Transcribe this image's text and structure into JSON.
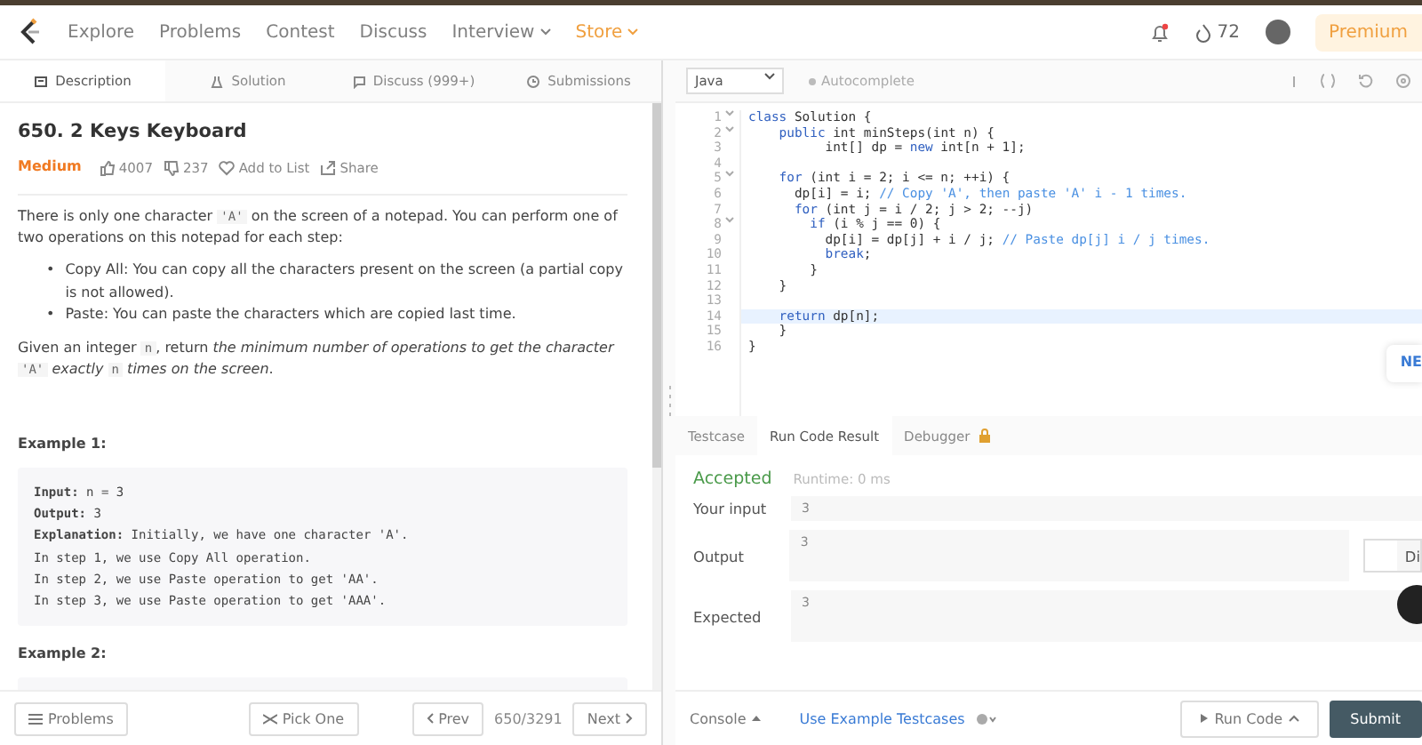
{
  "nav": {
    "links": [
      {
        "label": "Explore",
        "kind": "link"
      },
      {
        "label": "Problems",
        "kind": "link"
      },
      {
        "label": "Contest",
        "kind": "link"
      },
      {
        "label": "Discuss",
        "kind": "link"
      },
      {
        "label": "Interview",
        "kind": "menu"
      },
      {
        "label": "Store",
        "kind": "store"
      }
    ],
    "streak": "72",
    "premium": "Premium",
    "has_notification": true
  },
  "left": {
    "tabs": [
      {
        "label": "Description",
        "selected": true
      },
      {
        "label": "Solution",
        "selected": false
      },
      {
        "label": "Discuss (999+)",
        "selected": false
      },
      {
        "label": "Submissions",
        "selected": false
      }
    ],
    "title": "650. 2 Keys Keyboard",
    "difficulty": "Medium",
    "likes": "4007",
    "dislikes": "237",
    "add_to_list": "Add to List",
    "share": "Share",
    "intro": [
      {
        "text": "There is only one character ",
        "kind": "text"
      },
      {
        "text": "'A'",
        "kind": "code"
      },
      {
        "text": " on the screen of a notepad. You can perform one of two operations on this notepad for each step:",
        "kind": "text"
      }
    ],
    "bullets": [
      {
        "marker": "•",
        "text": "Copy All: You can copy all the characters present on the screen (a partial copy is not allowed)."
      },
      {
        "marker": "•",
        "text": "Paste: You can paste the characters which are copied last time."
      }
    ],
    "task": [
      {
        "text": "Given an integer ",
        "kind": "text"
      },
      {
        "text": "n",
        "kind": "code"
      },
      {
        "text": ", return ",
        "kind": "text"
      },
      {
        "text": "the minimum number of operations to get the character ",
        "kind": "italic"
      },
      {
        "text": "'A'",
        "kind": "code"
      },
      {
        "text": " exactly ",
        "kind": "italic"
      },
      {
        "text": "n",
        "kind": "code"
      },
      {
        "text": " times on the screen",
        "kind": "italic"
      },
      {
        "text": ".",
        "kind": "text"
      }
    ],
    "examples": [
      {
        "heading": "Example 1:",
        "lines": [
          "**Input:** n = 3",
          "**Output:** 3",
          "**Explanation:** Initially, we have one character 'A'.",
          "In step 1, we use Copy All operation.",
          "In step 2, we use Paste operation to get 'AA'.",
          "In step 3, we use Paste operation to get 'AAA'."
        ]
      },
      {
        "heading": "Example 2:"
      }
    ],
    "footer": {
      "problems": "Problems",
      "pick": "Pick One",
      "prev": "Prev",
      "count": "650/3291",
      "next": "Next"
    }
  },
  "editor": {
    "language": "Java",
    "autocomplete": "Autocomplete",
    "autocomplete_on": false,
    "lines": [
      {
        "num": "1",
        "fold": true,
        "highlighted": false,
        "segments": [
          {
            "text": "class",
            "kind": "keyword"
          },
          {
            "text": " Solution {",
            "kind": "plain"
          }
        ]
      },
      {
        "num": "2",
        "fold": true,
        "highlighted": false,
        "segments": [
          {
            "text": "    public",
            "kind": "keyword"
          },
          {
            "text": " int minSteps(int n) {",
            "kind": "plain"
          }
        ]
      },
      {
        "num": "3",
        "fold": false,
        "highlighted": false,
        "segments": [
          {
            "text": "          int[] dp = ",
            "kind": "plain"
          },
          {
            "text": "new",
            "kind": "keyword"
          },
          {
            "text": " int[n + 1];",
            "kind": "plain"
          }
        ]
      },
      {
        "num": "4",
        "fold": false,
        "highlighted": false
      },
      {
        "num": "5",
        "fold": true,
        "highlighted": false,
        "segments": [
          {
            "text": "    for",
            "kind": "keyword"
          },
          {
            "text": " (int i = 2; i <= n; ++i) {",
            "kind": "plain"
          }
        ]
      },
      {
        "num": "6",
        "fold": false,
        "highlighted": false,
        "segments": [
          {
            "text": "      dp[i] = i; ",
            "kind": "plain"
          },
          {
            "text": "// Copy 'A', then paste 'A' i - 1 times.",
            "kind": "comment"
          }
        ]
      },
      {
        "num": "7",
        "fold": false,
        "highlighted": false,
        "segments": [
          {
            "text": "      for",
            "kind": "keyword"
          },
          {
            "text": " (int j = i / 2; j > 2; --j)",
            "kind": "plain"
          }
        ]
      },
      {
        "num": "8",
        "fold": true,
        "highlighted": false,
        "segments": [
          {
            "text": "        if",
            "kind": "keyword"
          },
          {
            "text": " (i % j == 0) {",
            "kind": "plain"
          }
        ]
      },
      {
        "num": "9",
        "fold": false,
        "highlighted": false,
        "segments": [
          {
            "text": "          dp[i] = dp[j] + i / j; ",
            "kind": "plain"
          },
          {
            "text": "// Paste dp[j] i / j times.",
            "kind": "comment"
          }
        ]
      },
      {
        "num": "10",
        "fold": false,
        "highlighted": false,
        "segments": [
          {
            "text": "          break",
            "kind": "keyword"
          },
          {
            "text": ";",
            "kind": "plain"
          }
        ]
      },
      {
        "num": "11",
        "fold": false,
        "highlighted": false,
        "segments": [
          {
            "text": "        }",
            "kind": "plain"
          }
        ]
      },
      {
        "num": "12",
        "fold": false,
        "highlighted": false,
        "segments": [
          {
            "text": "    }",
            "kind": "plain"
          }
        ]
      },
      {
        "num": "13",
        "fold": false,
        "highlighted": false
      },
      {
        "num": "14",
        "fold": false,
        "highlighted": true,
        "segments": [
          {
            "text": "    return",
            "kind": "keyword"
          },
          {
            "text": " dp[n];",
            "kind": "plain"
          }
        ]
      },
      {
        "num": "15",
        "fold": false,
        "highlighted": false,
        "segments": [
          {
            "text": "    }",
            "kind": "plain"
          }
        ]
      },
      {
        "num": "16",
        "fold": false,
        "highlighted": false,
        "segments": [
          {
            "text": "}",
            "kind": "plain"
          }
        ]
      }
    ],
    "new_badge": "NE"
  },
  "console": {
    "tabs": [
      {
        "label": "Testcase",
        "locked": false,
        "selected": false
      },
      {
        "label": "Run Code Result",
        "locked": false,
        "selected": true
      },
      {
        "label": "Debugger",
        "locked": true,
        "selected": false
      }
    ],
    "status": "Accepted",
    "runtime": "Runtime: 0 ms",
    "fields": [
      {
        "label": "Your input",
        "value": "3",
        "kind": "input"
      },
      {
        "label": "Output",
        "value": "3",
        "kind": "output"
      },
      {
        "label": "Expected",
        "value": "3",
        "kind": "expected"
      }
    ],
    "diff_label": "Di",
    "diff_on": false
  },
  "footer": {
    "console": "Console",
    "example": "Use Example Testcases",
    "run": "Run Code",
    "submit": "Submit"
  }
}
